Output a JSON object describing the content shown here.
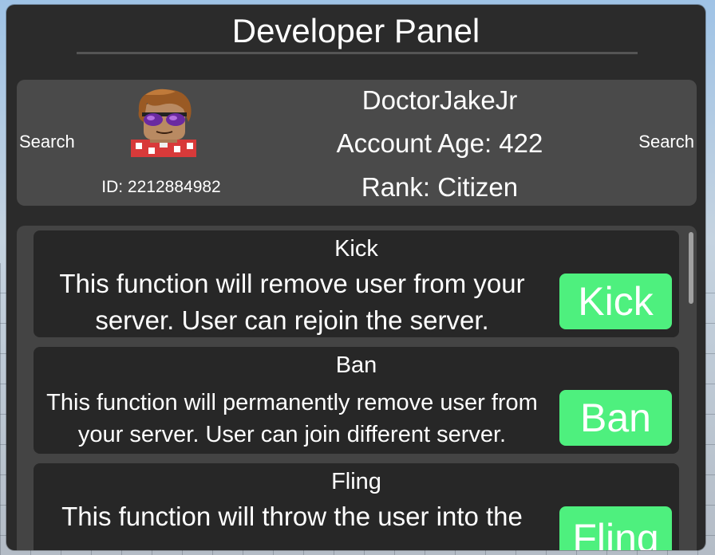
{
  "panel": {
    "title": "Developer Panel"
  },
  "user": {
    "search_left_label": "Search",
    "search_right_label": "Search",
    "id_text": "ID: 2212884982",
    "name": "DoctorJakeJr",
    "account_age": "Account Age: 422",
    "rank": "Rank: Citizen"
  },
  "functions": [
    {
      "title": "Kick",
      "description": "This function will remove user from your server. User can rejoin the server.",
      "button_label": "Kick"
    },
    {
      "title": "Ban",
      "description": "This function will permanently remove user from your server. User can join different server.",
      "button_label": "Ban"
    },
    {
      "title": "Fling",
      "description": "This function will throw the user into the",
      "button_label": "Fling"
    }
  ],
  "colors": {
    "panel_bg": "#2b2b2b",
    "card_bg": "#4a4a4a",
    "function_card_bg": "#272727",
    "action_button": "#4ef07e",
    "text": "#ffffff"
  },
  "icons": {
    "avatar": "avatar-headshot"
  }
}
